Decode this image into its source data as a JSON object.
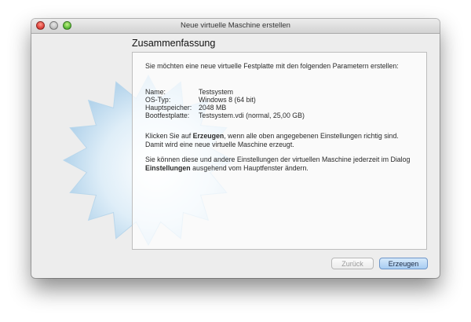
{
  "window": {
    "title": "Neue virtuelle Maschine erstellen"
  },
  "page": {
    "heading": "Zusammenfassung",
    "intro": "Sie möchten eine neue virtuelle Festplatte mit den folgenden Parametern erstellen:",
    "params": [
      {
        "label": "Name:",
        "value": "Testsystem"
      },
      {
        "label": "OS-Typ:",
        "value": "Windows 8 (64 bit)"
      },
      {
        "label": "Hauptspeicher:",
        "value": "2048 MB"
      },
      {
        "label": "Bootfestplatte:",
        "value": "Testsystem.vdi (normal, 25,00 GB)"
      }
    ],
    "info1": {
      "pre": "Klicken Sie auf ",
      "bold": "Erzeugen",
      "post": ", wenn alle oben angegebenen Einstellungen richtig sind. Damit wird eine neue virtuelle Maschine erzeugt."
    },
    "info2": {
      "pre": "Sie können diese und andere Einstellungen der virtuellen Maschine jederzeit im Dialog ",
      "bold": "Einstellungen",
      "post": " ausgehend vom Hauptfenster ändern."
    }
  },
  "buttons": {
    "back": "Zurück",
    "create": "Erzeugen"
  },
  "colors": {
    "accent": "#a8cdf2",
    "close": "#e0443e",
    "minimize": "#c2c2c2",
    "zoom": "#5ebf3a"
  },
  "icons": {
    "background": "starburst-icon",
    "close": "close-icon",
    "minimize": "minimize-icon",
    "zoom": "zoom-icon"
  }
}
